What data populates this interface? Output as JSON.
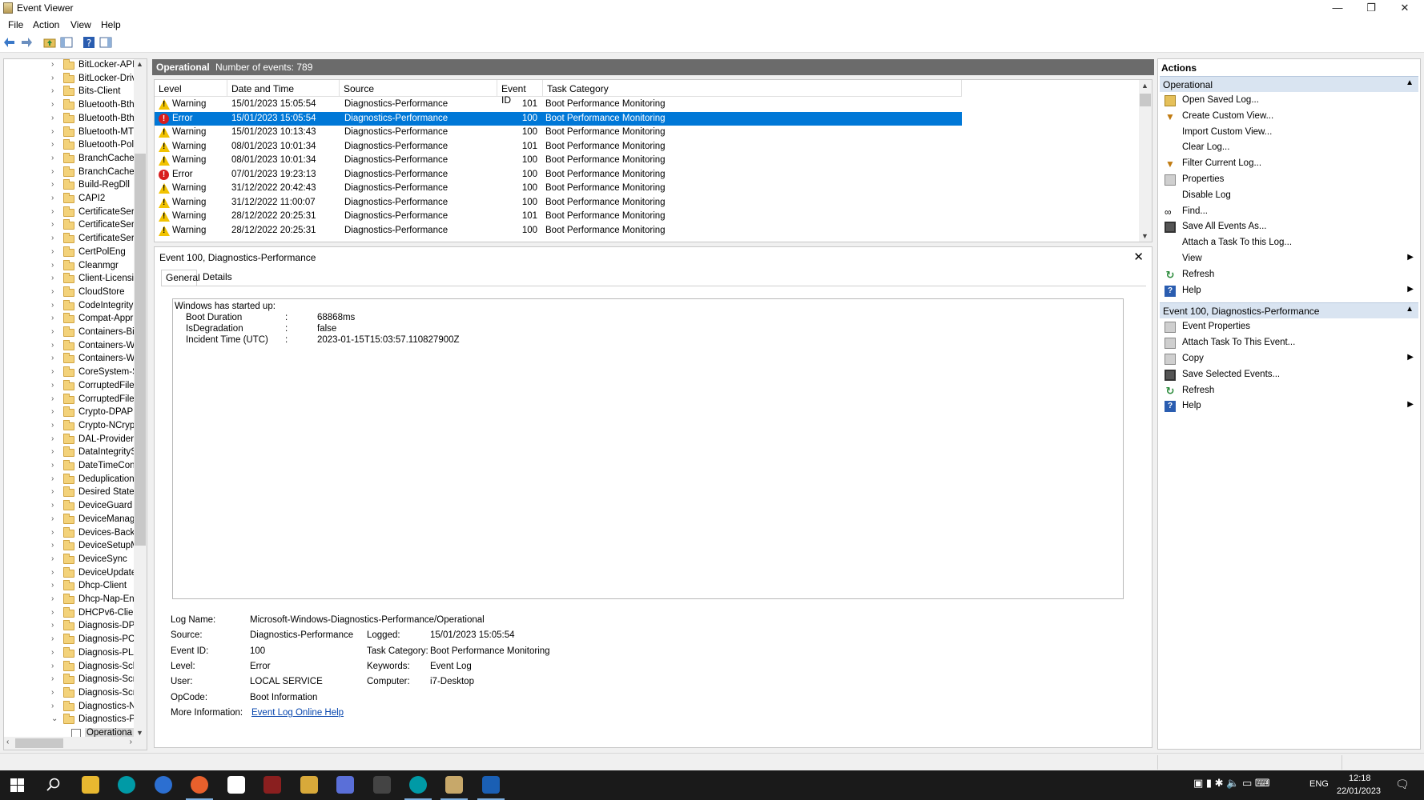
{
  "window": {
    "title": "Event Viewer",
    "minimize_glyph": "—",
    "maximize_glyph": "❐",
    "close_glyph": "✕"
  },
  "menu": [
    "File",
    "Action",
    "View",
    "Help"
  ],
  "tree": {
    "items": [
      "BitLocker-API",
      "BitLocker-Driv",
      "Bits-Client",
      "Bluetooth-Bth",
      "Bluetooth-Bth",
      "Bluetooth-MTI",
      "Bluetooth-Poli",
      "BranchCache",
      "BranchCacheS",
      "Build-RegDll",
      "CAPI2",
      "CertificateServ",
      "CertificateServ",
      "CertificateServ",
      "CertPolEng",
      "Cleanmgr",
      "Client-Licensir",
      "CloudStore",
      "CodeIntegrity",
      "Compat-Appr",
      "Containers-Bir",
      "Containers-Wc",
      "Containers-Wc",
      "CoreSystem-Sr",
      "CorruptedFileF",
      "CorruptedFileF",
      "Crypto-DPAPI",
      "Crypto-NCryp",
      "DAL-Provider",
      "DataIntegritySc",
      "DateTimeCont",
      "Deduplication",
      "Desired State C",
      "DeviceGuard",
      "DeviceManage",
      "Devices-Backg",
      "DeviceSetupM",
      "DeviceSync",
      "DeviceUpdate/",
      "Dhcp-Client",
      "Dhcp-Nap-Enf",
      "DHCPv6-Clien",
      "Diagnosis-DPS",
      "Diagnosis-PCV",
      "Diagnosis-PLA",
      "Diagnosis-Sch",
      "Diagnosis-Scri",
      "Diagnosis-Scri",
      "Diagnostics-N",
      "Diagnostics-Pe"
    ],
    "child": "Operationa"
  },
  "log_header": {
    "name": "Operational",
    "count": "Number of events: 789"
  },
  "events": {
    "columns": [
      "Level",
      "Date and Time",
      "Source",
      "Event ID",
      "Task Category"
    ],
    "rows": [
      {
        "level": "Warning",
        "date": "15/01/2023 15:05:54",
        "source": "Diagnostics-Performance",
        "id": "101",
        "task": "Boot Performance Monitoring"
      },
      {
        "level": "Error",
        "date": "15/01/2023 15:05:54",
        "source": "Diagnostics-Performance",
        "id": "100",
        "task": "Boot Performance Monitoring"
      },
      {
        "level": "Warning",
        "date": "15/01/2023 10:13:43",
        "source": "Diagnostics-Performance",
        "id": "100",
        "task": "Boot Performance Monitoring"
      },
      {
        "level": "Warning",
        "date": "08/01/2023 10:01:34",
        "source": "Diagnostics-Performance",
        "id": "101",
        "task": "Boot Performance Monitoring"
      },
      {
        "level": "Warning",
        "date": "08/01/2023 10:01:34",
        "source": "Diagnostics-Performance",
        "id": "100",
        "task": "Boot Performance Monitoring"
      },
      {
        "level": "Error",
        "date": "07/01/2023 19:23:13",
        "source": "Diagnostics-Performance",
        "id": "100",
        "task": "Boot Performance Monitoring"
      },
      {
        "level": "Warning",
        "date": "31/12/2022 20:42:43",
        "source": "Diagnostics-Performance",
        "id": "100",
        "task": "Boot Performance Monitoring"
      },
      {
        "level": "Warning",
        "date": "31/12/2022 11:00:07",
        "source": "Diagnostics-Performance",
        "id": "100",
        "task": "Boot Performance Monitoring"
      },
      {
        "level": "Warning",
        "date": "28/12/2022 20:25:31",
        "source": "Diagnostics-Performance",
        "id": "101",
        "task": "Boot Performance Monitoring"
      },
      {
        "level": "Warning",
        "date": "28/12/2022 20:25:31",
        "source": "Diagnostics-Performance",
        "id": "100",
        "task": "Boot Performance Monitoring"
      }
    ]
  },
  "detail": {
    "title": "Event 100, Diagnostics-Performance",
    "tabs": [
      "General",
      "Details"
    ],
    "description": {
      "intro": "Windows has started up:",
      "lines": [
        {
          "k": "Boot Duration",
          "sep": ":",
          "v": "68868ms"
        },
        {
          "k": "IsDegradation",
          "sep": ":",
          "v": "false"
        },
        {
          "k": "Incident Time (UTC)",
          "sep": ":",
          "v": "2023-01-15T15:03:57.110827900Z"
        }
      ]
    },
    "props": {
      "log_name_label": "Log Name:",
      "log_name": "Microsoft-Windows-Diagnostics-Performance/Operational",
      "source_label": "Source:",
      "source": "Diagnostics-Performance",
      "logged_label": "Logged:",
      "logged": "15/01/2023 15:05:54",
      "event_id_label": "Event ID:",
      "event_id": "100",
      "task_label": "Task Category:",
      "task": "Boot Performance Monitoring",
      "level_label": "Level:",
      "level": "Error",
      "keywords_label": "Keywords:",
      "keywords": "Event Log",
      "user_label": "User:",
      "user": "LOCAL SERVICE",
      "computer_label": "Computer:",
      "computer": "i7-Desktop",
      "opcode_label": "OpCode:",
      "opcode": "Boot Information",
      "more_label": "More Information:",
      "more_link": "Event Log Online Help"
    }
  },
  "actions": {
    "title": "Actions",
    "section1": {
      "label": "Operational",
      "items": [
        {
          "label": "Open Saved Log...",
          "icon": "folder-open-icon"
        },
        {
          "label": "Create Custom View...",
          "icon": "filter-icon"
        },
        {
          "label": "Import Custom View...",
          "icon": ""
        },
        {
          "label": "Clear Log...",
          "icon": ""
        },
        {
          "label": "Filter Current Log...",
          "icon": "filter-icon"
        },
        {
          "label": "Properties",
          "icon": "properties-icon"
        },
        {
          "label": "Disable Log",
          "icon": ""
        },
        {
          "label": "Find...",
          "icon": "binoculars-icon"
        },
        {
          "label": "Save All Events As...",
          "icon": "save-icon"
        },
        {
          "label": "Attach a Task To this Log...",
          "icon": ""
        },
        {
          "label": "View",
          "icon": "",
          "submenu": true
        },
        {
          "label": "Refresh",
          "icon": "refresh-icon"
        },
        {
          "label": "Help",
          "icon": "help-icon",
          "submenu": true
        }
      ]
    },
    "section2": {
      "label": "Event 100, Diagnostics-Performance",
      "items": [
        {
          "label": "Event Properties",
          "icon": "properties-icon"
        },
        {
          "label": "Attach Task To This Event...",
          "icon": "task-icon"
        },
        {
          "label": "Copy",
          "icon": "copy-icon",
          "submenu": true
        },
        {
          "label": "Save Selected Events...",
          "icon": "save-icon"
        },
        {
          "label": "Refresh",
          "icon": "refresh-icon"
        },
        {
          "label": "Help",
          "icon": "help-icon",
          "submenu": true
        }
      ]
    }
  },
  "taskbar": {
    "lang": "ENG",
    "time": "12:18",
    "date": "22/01/2023"
  },
  "colors": {
    "selection": "#0078d7",
    "section_bg": "#d9e4f1",
    "header_bg": "#6b6b6b",
    "taskbar_bg": "#1a1a1a"
  }
}
